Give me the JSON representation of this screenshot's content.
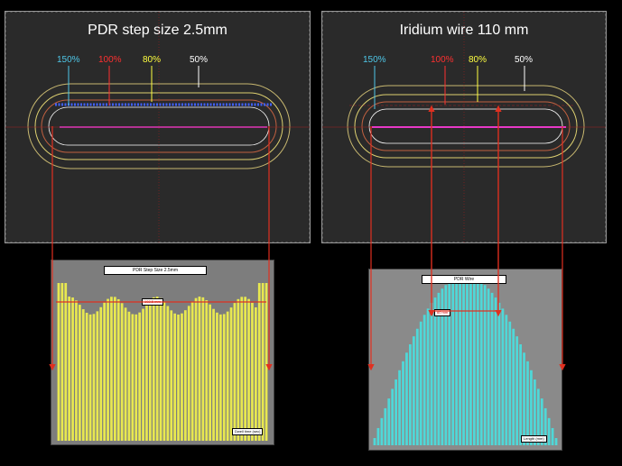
{
  "left": {
    "title": "PDR step size 2.5mm",
    "iso_labels": [
      {
        "text": "150%",
        "color": "#4fc7e8"
      },
      {
        "text": "100%",
        "color": "#ff3030"
      },
      {
        "text": "80%",
        "color": "#ffff40"
      },
      {
        "text": "50%",
        "color": "#ffffff"
      }
    ],
    "histogram": {
      "title": "PDR Step Size 2.5mm",
      "span_label": "102.5 mm",
      "bar_color": "#e8e850",
      "footer": "Dwell time (sec)"
    }
  },
  "right": {
    "title": "Iridium wire 110 mm",
    "iso_labels": [
      {
        "text": "150%",
        "color": "#4fc7e8"
      },
      {
        "text": "100%",
        "color": "#ff3030"
      },
      {
        "text": "80%",
        "color": "#ffff40"
      },
      {
        "text": "50%",
        "color": "#ffffff"
      }
    ],
    "histogram": {
      "title": "PDR Wire",
      "span_label": "60 mm",
      "bar_color": "#4fd8d8",
      "footer": "Length (mm)"
    }
  },
  "colors": {
    "background": "#000000",
    "panel": "#2a2a2a",
    "arrow": "#e03020"
  }
}
